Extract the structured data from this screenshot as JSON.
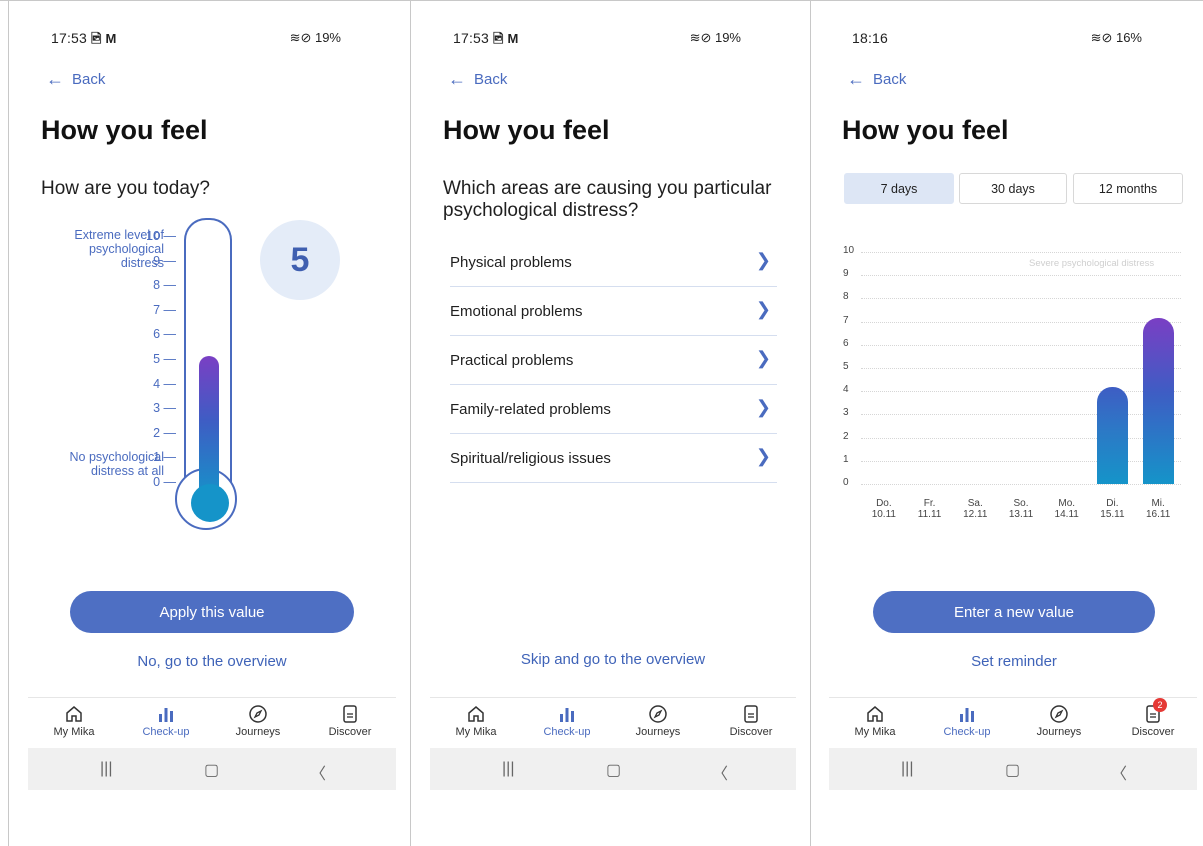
{
  "screens": [
    {
      "status": {
        "time": "17:53",
        "notif_icons": "🖻 M",
        "right": "≋⊘ 19%"
      },
      "back_label": "Back",
      "title": "How you feel",
      "question": "How are you today?",
      "scale_top_label": "Extreme level of psychological distress",
      "scale_bottom_label": "No psychological distress at all",
      "scale_ticks": [
        "10",
        "9",
        "8",
        "7",
        "6",
        "5",
        "4",
        "3",
        "2",
        "1",
        "0"
      ],
      "selected_value": 5,
      "primary_button": "Apply this value",
      "secondary_link": "No, go to the overview"
    },
    {
      "status": {
        "time": "17:53",
        "notif_icons": "🖻 M",
        "right": "≋⊘ 19%"
      },
      "back_label": "Back",
      "title": "How you feel",
      "question": "Which areas are causing you particular psychological distress?",
      "categories": [
        "Physical problems",
        "Emotional problems",
        "Practical problems",
        "Family-related problems",
        "Spiritual/religious issues"
      ],
      "skip_link": "Skip and go to the overview"
    },
    {
      "status": {
        "time": "18:16",
        "notif_icons": "",
        "right": "≋⊘ 16%"
      },
      "back_label": "Back",
      "title": "How you feel",
      "tabs": [
        "7 days",
        "30 days",
        "12 months"
      ],
      "active_tab": 0,
      "primary_button": "Enter a new value",
      "secondary_link": "Set reminder",
      "discover_badge": "2"
    }
  ],
  "nav": {
    "items": [
      {
        "label": "My Mika",
        "icon": "home-icon"
      },
      {
        "label": "Check-up",
        "icon": "bar-chart-icon"
      },
      {
        "label": "Journeys",
        "icon": "compass-icon"
      },
      {
        "label": "Discover",
        "icon": "document-icon"
      }
    ],
    "active_index": 1
  },
  "chart_data": {
    "type": "bar",
    "categories": [
      "Do.\n10.11",
      "Fr.\n11.11",
      "Sa.\n12.11",
      "So.\n13.11",
      "Mo.\n14.11",
      "Di.\n15.11",
      "Mi.\n16.11"
    ],
    "values": [
      null,
      null,
      null,
      null,
      null,
      4,
      7
    ],
    "ylim": [
      0,
      10
    ],
    "yticks": [
      0,
      1,
      2,
      3,
      4,
      5,
      6,
      7,
      8,
      9,
      10
    ],
    "annotation": "Severe psychological distress",
    "grid": true
  },
  "colors": {
    "accent": "#4e6fc3",
    "link": "#3f63b8",
    "gradient_top": "#7a3fc4",
    "gradient_bottom": "#1594c9",
    "badge": "#e53935"
  }
}
